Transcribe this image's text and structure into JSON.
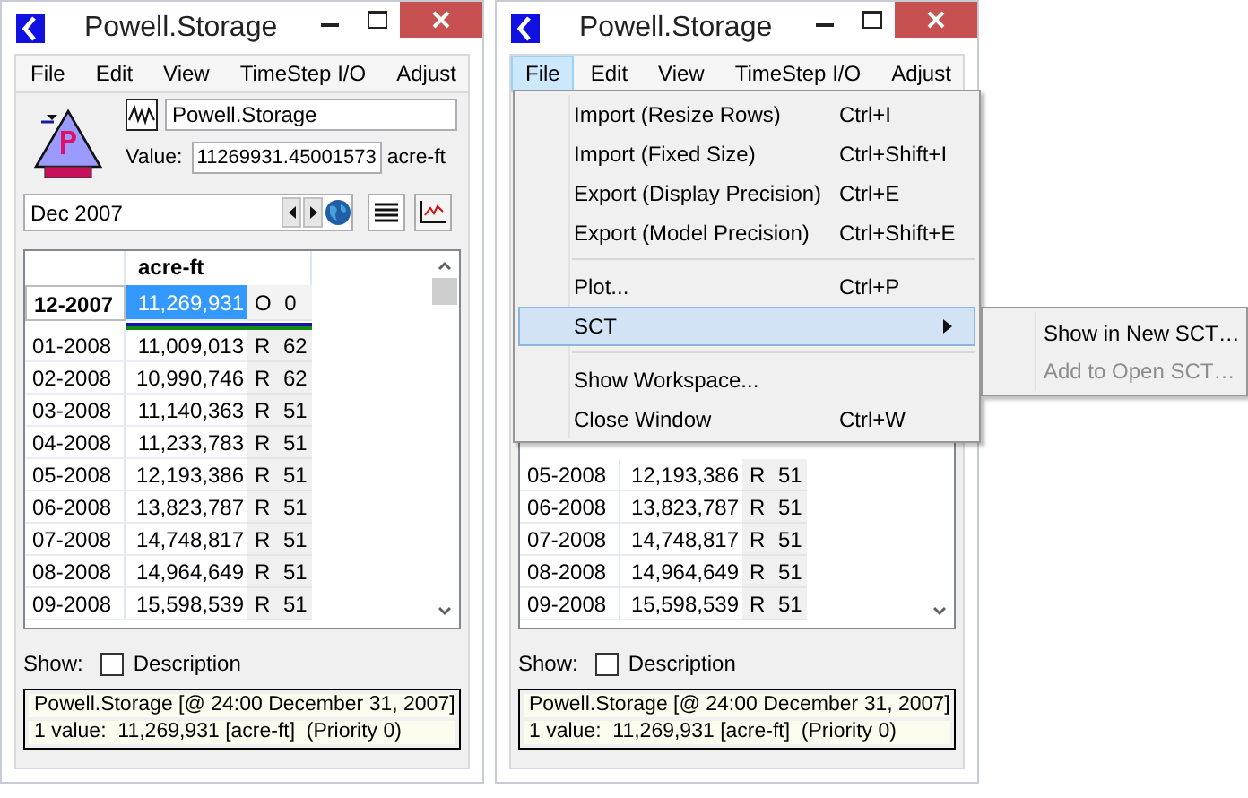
{
  "windows": [
    {
      "title": "Powell.Storage",
      "menu_bar": [
        {
          "label": "File",
          "selected": false
        },
        {
          "label": "Edit",
          "selected": false
        },
        {
          "label": "View",
          "selected": false
        },
        {
          "label": "TimeStep I/O",
          "selected": false
        },
        {
          "label": "Adjust",
          "selected": false
        }
      ],
      "object_name": "Powell.Storage",
      "value_label": "Value:",
      "value": "11269931.45001573",
      "units": "acre-ft",
      "date": "Dec 2007",
      "table": {
        "column_2": "acre-ft",
        "rows": [
          {
            "date": "12-2007",
            "value": "11,269,931",
            "flag": "O 0",
            "selected": true
          },
          {
            "date": "01-2008",
            "value": "11,009,013",
            "flag": "R 62",
            "selected": false
          },
          {
            "date": "02-2008",
            "value": "10,990,746",
            "flag": "R 62",
            "selected": false
          },
          {
            "date": "03-2008",
            "value": "11,140,363",
            "flag": "R 51",
            "selected": false
          },
          {
            "date": "04-2008",
            "value": "11,233,783",
            "flag": "R 51",
            "selected": false
          },
          {
            "date": "05-2008",
            "value": "12,193,386",
            "flag": "R 51",
            "selected": false
          },
          {
            "date": "06-2008",
            "value": "13,823,787",
            "flag": "R 51",
            "selected": false
          },
          {
            "date": "07-2008",
            "value": "14,748,817",
            "flag": "R 51",
            "selected": false
          },
          {
            "date": "08-2008",
            "value": "14,964,649",
            "flag": "R 51",
            "selected": false
          },
          {
            "date": "09-2008",
            "value": "15,598,539",
            "flag": "R 51",
            "selected": false
          }
        ]
      },
      "show_label": "Show:",
      "description": {
        "label": "Description",
        "checked": false
      },
      "info": [
        "Powell.Storage [@ 24:00 December 31, 2007]",
        "1 value:  11,269,931 [acre-ft]  (Priority 0)"
      ]
    },
    {
      "title": "Powell.Storage",
      "menu_bar": [
        {
          "label": "File",
          "selected": true
        },
        {
          "label": "Edit",
          "selected": false
        },
        {
          "label": "View",
          "selected": false
        },
        {
          "label": "TimeStep I/O",
          "selected": false
        },
        {
          "label": "Adjust",
          "selected": false
        }
      ],
      "table": {
        "rows": [
          {
            "date": "05-2008",
            "value": "12,193,386",
            "flag": "R 51",
            "selected": false
          },
          {
            "date": "06-2008",
            "value": "13,823,787",
            "flag": "R 51",
            "selected": false
          },
          {
            "date": "07-2008",
            "value": "14,748,817",
            "flag": "R 51",
            "selected": false
          },
          {
            "date": "08-2008",
            "value": "14,964,649",
            "flag": "R 51",
            "selected": false
          },
          {
            "date": "09-2008",
            "value": "15,598,539",
            "flag": "R 51",
            "selected": false
          }
        ]
      },
      "show_label": "Show:",
      "description": {
        "label": "Description",
        "checked": false
      },
      "info": [
        "Powell.Storage [@ 24:00 December 31, 2007]",
        "1 value:  11,269,931 [acre-ft]  (Priority 0)"
      ],
      "file_menu": [
        {
          "kind": "item",
          "label": "Import (Resize Rows)",
          "shortcut": "Ctrl+I"
        },
        {
          "kind": "item",
          "label": "Import (Fixed Size)",
          "shortcut": "Ctrl+Shift+I"
        },
        {
          "kind": "item",
          "label": "Export (Display Precision)",
          "shortcut": "Ctrl+E"
        },
        {
          "kind": "item",
          "label": "Export (Model Precision)",
          "shortcut": "Ctrl+Shift+E"
        },
        {
          "kind": "separator"
        },
        {
          "kind": "item",
          "label": "Plot...",
          "shortcut": "Ctrl+P"
        },
        {
          "kind": "submenu",
          "label": "SCT",
          "selected": true,
          "items": [
            {
              "label": "Show in New SCT…",
              "disabled": false
            },
            {
              "label": "Add to Open SCT…",
              "disabled": true
            }
          ]
        },
        {
          "kind": "separator"
        },
        {
          "kind": "item",
          "label": "Show Workspace..."
        },
        {
          "kind": "item",
          "label": "Close Window",
          "shortcut": "Ctrl+W"
        }
      ]
    }
  ]
}
